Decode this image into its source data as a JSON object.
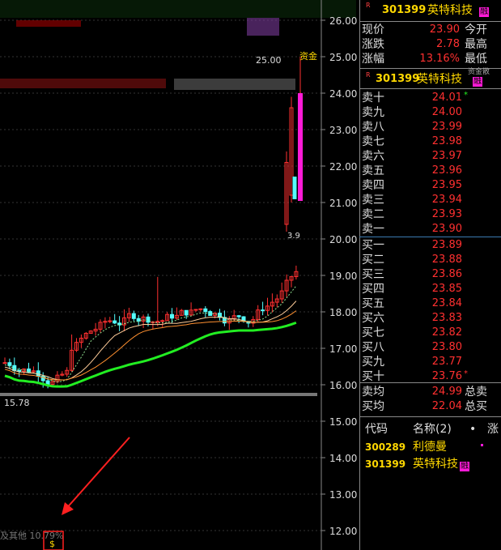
{
  "header": {
    "stock_code": "301399",
    "stock_name": "英特科技",
    "badge": "融"
  },
  "quote": [
    {
      "label": "现价",
      "value": "23.90",
      "extra": "今开"
    },
    {
      "label": "涨跌",
      "value": "2.78",
      "extra": "最高"
    },
    {
      "label": "涨幅",
      "value": "13.16%",
      "extra": "最低"
    }
  ],
  "orderbook_header": {
    "stock_code": "301399",
    "stock_name": "英特科技",
    "badge": "融",
    "side_text": "资金散"
  },
  "sell": [
    {
      "label": "卖十",
      "price": "24.01",
      "flag": "*"
    },
    {
      "label": "卖九",
      "price": "24.00"
    },
    {
      "label": "卖八",
      "price": "23.99"
    },
    {
      "label": "卖七",
      "price": "23.98"
    },
    {
      "label": "卖六",
      "price": "23.97"
    },
    {
      "label": "卖五",
      "price": "23.96"
    },
    {
      "label": "卖四",
      "price": "23.95"
    },
    {
      "label": "卖三",
      "price": "23.94"
    },
    {
      "label": "卖二",
      "price": "23.93"
    },
    {
      "label": "卖一",
      "price": "23.90"
    }
  ],
  "buy": [
    {
      "label": "买一",
      "price": "23.89"
    },
    {
      "label": "买二",
      "price": "23.88"
    },
    {
      "label": "买三",
      "price": "23.86"
    },
    {
      "label": "买四",
      "price": "23.85"
    },
    {
      "label": "买五",
      "price": "23.84"
    },
    {
      "label": "买六",
      "price": "23.83"
    },
    {
      "label": "买七",
      "price": "23.82"
    },
    {
      "label": "买八",
      "price": "23.80"
    },
    {
      "label": "买九",
      "price": "23.77"
    },
    {
      "label": "买十",
      "price": "23.76",
      "flag": "*"
    }
  ],
  "averages": [
    {
      "label": "卖均",
      "value": "24.99",
      "extra": "总卖"
    },
    {
      "label": "买均",
      "value": "22.04",
      "extra": "总买"
    }
  ],
  "watchlist": {
    "columns": [
      "代码",
      "名称(2)",
      "•",
      "涨"
    ],
    "rows": [
      {
        "code": "300289",
        "name": "利德曼",
        "badge": ""
      },
      {
        "code": "301399",
        "name": "英特科技",
        "badge": "融"
      }
    ]
  },
  "chart": {
    "price_axis": [
      "26.00",
      "25.00",
      "24.00",
      "23.00",
      "22.00",
      "21.00",
      "20.00",
      "19.00",
      "18.00",
      "17.00",
      "16.00",
      "15.00",
      "14.00",
      "13.00",
      "12.00"
    ],
    "high_label": "25.00",
    "high_annotation": "资金",
    "mid_annotation": "3.9",
    "low_label": "15.78",
    "bottom_text": "及其他 10.79%",
    "bottom_icon": "$"
  },
  "colors": {
    "up": "#ff3030",
    "down": "#54ffff",
    "ma_green": "#22ee22",
    "ma_orange": "#ff9030",
    "highlight": "#ff1ad8",
    "arrow": "#ff2020"
  }
}
